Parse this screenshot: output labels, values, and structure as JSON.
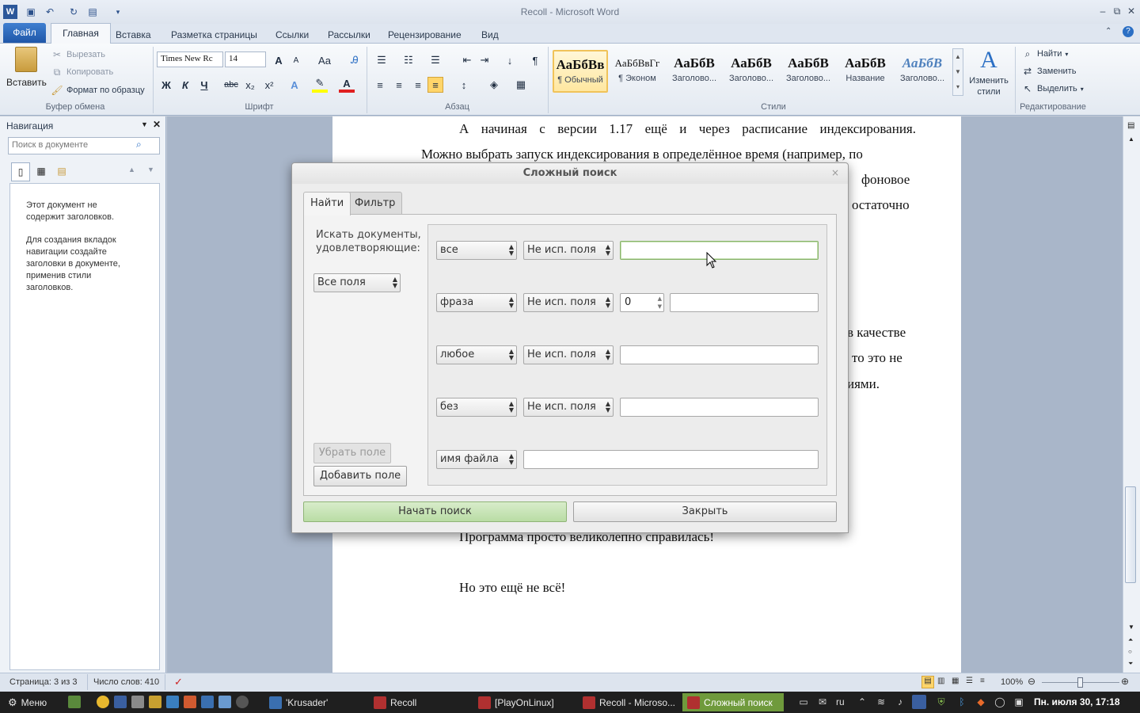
{
  "window": {
    "title": "Recoll - Microsoft Word",
    "controls": {
      "minimize": "–",
      "restore": "⧉",
      "close": "✕"
    }
  },
  "quick_access": [
    "word-icon",
    "save-icon",
    "undo-icon",
    "redo-icon",
    "print-preview-icon",
    "customize-icon"
  ],
  "ribbon": {
    "tabs": {
      "file": "Файл",
      "home": "Главная",
      "insert": "Вставка",
      "layout": "Разметка страницы",
      "refs": "Ссылки",
      "mailings": "Рассылки",
      "review": "Рецензирование",
      "view": "Вид"
    },
    "clipboard": {
      "label": "Буфер обмена",
      "paste": "Вставить",
      "cut": "Вырезать",
      "copy": "Копировать",
      "format_painter": "Формат по образцу"
    },
    "font": {
      "label": "Шрифт",
      "name": "Times New Rc",
      "size": "14",
      "bold": "Ж",
      "italic": "К",
      "underline": "Ч",
      "strike": "abc",
      "sub": "x₂",
      "sup": "x²",
      "grow": "A",
      "shrink": "A",
      "case": "Aa",
      "color": "A"
    },
    "paragraph": {
      "label": "Абзац",
      "pilcrow": "¶"
    },
    "styles": {
      "label": "Стили",
      "items": [
        {
          "sample": "АаБбВв",
          "name": "¶ Обычный"
        },
        {
          "sample": "АаБбВвГг",
          "name": "¶ Эконом"
        },
        {
          "sample": "АаБбВ",
          "name": "Заголово..."
        },
        {
          "sample": "АаБбВ",
          "name": "Заголово..."
        },
        {
          "sample": "АаБбВ",
          "name": "Заголово..."
        },
        {
          "sample": "АаБбВ",
          "name": "Название"
        },
        {
          "sample": "АаБбВ",
          "name": "Заголово..."
        }
      ],
      "change": "Изменить стили"
    },
    "editing": {
      "label": "Редактирование",
      "find": "Найти",
      "replace": "Заменить",
      "select": "Выделить"
    }
  },
  "nav": {
    "title": "Навигация",
    "search_placeholder": "Поиск в документе",
    "msg1": "Этот документ не содержит заголовков.",
    "msg2": "Для создания вкладок навигации создайте заголовки в документе, применив стили заголовков."
  },
  "document": {
    "line1": "А начиная с версии 1.17 ещё и через расписание индексирования.",
    "line2": "Можно выбрать запуск индексирования в определённое время (например, по",
    "frag1": "фоновое",
    "frag2": "остаточно",
    "frag3": "в качестве",
    "frag4": "то это не",
    "frag5": "иями.",
    "line3": "Программа просто великолепно справилась!",
    "line4": "Но это ещё не всё!"
  },
  "statusbar": {
    "page": "Страница: 3 из 3",
    "words": "Число слов: 410",
    "zoom": "100%",
    "zoom_level": 0.5
  },
  "dialog": {
    "title": "Сложный поиск",
    "close": "×",
    "tabs": {
      "find": "Найти",
      "filter": "Фильтр"
    },
    "intro": "Искать документы, удовлетворяющие:",
    "mode": "Все поля",
    "rows": [
      {
        "type": "все",
        "field": "Не исп. поля",
        "value": ""
      },
      {
        "type": "фраза",
        "field": "Не исп. поля",
        "proximity": "0",
        "value": ""
      },
      {
        "type": "любое",
        "field": "Не исп. поля",
        "value": ""
      },
      {
        "type": "без",
        "field": "Не исп. поля",
        "value": ""
      },
      {
        "type": "имя файла",
        "value": ""
      }
    ],
    "remove_field": "Убрать поле",
    "add_field": "Добавить поле",
    "start": "Начать поиск",
    "close_btn": "Закрыть"
  },
  "taskbar": {
    "menu": "Меню",
    "windows": [
      "'Krusader'",
      "Recoll",
      "[PlayOnLinux]",
      "Recoll - Microso...",
      "Сложный поиск"
    ],
    "lang": "ru",
    "clock": "Пн. июля 30, 17:18"
  },
  "colors": {
    "accent": "#2b579a",
    "start_button": "#b9dca4",
    "active_task": "#6f9a3c"
  }
}
